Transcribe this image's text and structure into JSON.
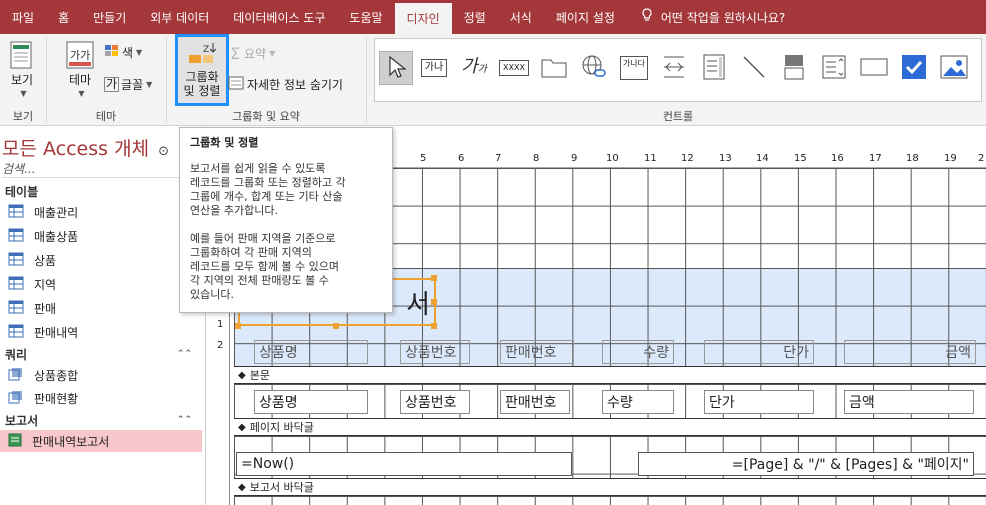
{
  "colors": {
    "accent": "#a4373a",
    "selection": "#1e90ff",
    "nav_selected": "#f7c7cb",
    "section_blue": "#dbe9fb",
    "handle": "#f0a030"
  },
  "tabs": [
    {
      "label": "파일"
    },
    {
      "label": "홈"
    },
    {
      "label": "만들기"
    },
    {
      "label": "외부 데이터"
    },
    {
      "label": "데이터베이스 도구"
    },
    {
      "label": "도움말"
    },
    {
      "label": "디자인",
      "active": true
    },
    {
      "label": "정렬"
    },
    {
      "label": "서식"
    },
    {
      "label": "페이지 설정"
    }
  ],
  "tell_me": "어떤 작업을 원하시나요?",
  "ribbon": {
    "view": {
      "button": "보기",
      "group": "보기"
    },
    "theme": {
      "button": "테마",
      "color": "색",
      "font": "글꼴",
      "group": "테마"
    },
    "grouping": {
      "button_line1": "그룹화",
      "button_line2": "및 정렬",
      "summary": "요약",
      "hide_details": "자세한 정보 숨기기",
      "group": "그룹화 및 요약"
    },
    "controls": {
      "group": "컨트롤",
      "textbox_sample": "가나",
      "label_sample": "가",
      "label_sub": "가",
      "number_sample": "XXXX",
      "image_sample": "가나다"
    }
  },
  "nav": {
    "title": "모든 Access 개체",
    "search_placeholder": "검색...",
    "sections": [
      {
        "label": "테이블",
        "items": [
          "매출관리",
          "매출상품",
          "상품",
          "지역",
          "판매",
          "판매내역"
        ]
      },
      {
        "label": "쿼리",
        "items": [
          "상품종합",
          "판매현황"
        ]
      },
      {
        "label": "보고서",
        "items": [
          "판매내역보고서"
        ]
      }
    ]
  },
  "tooltip": {
    "title": "그룹화 및 정렬",
    "p1": "보고서를 쉽게 읽을 수 있도록\n레코드를 그룹화 또는 정렬하고 각\n그룹에 개수, 합계 또는 기타 산술\n연산을 추가합니다.",
    "p2": "예를 들어 판매 지역을 기준으로\n그룹화하여 각 판매 지역의\n레코드를 모두 함께 볼 수 있으며\n각 지역의 전체 판매량도 볼 수\n있습니다."
  },
  "ruler": {
    "numbers": [
      "5",
      "6",
      "7",
      "8",
      "9",
      "10",
      "11",
      "12",
      "13",
      "14",
      "15",
      "16",
      "17",
      "18",
      "19",
      "2"
    ]
  },
  "vruler": {
    "marks": [
      "1",
      "2"
    ]
  },
  "report": {
    "title_fragment": "서",
    "sections": {
      "detail": "본문",
      "page_footer": "페이지 바닥글",
      "report_footer": "보고서 바닥글"
    },
    "header_labels": [
      "상품명",
      "상품번호",
      "판매번호",
      "수량",
      "단가",
      "금액"
    ],
    "detail_fields": [
      "상품명",
      "상품번호",
      "판매번호",
      "수량",
      "단가",
      "금액"
    ],
    "page_footer_left": "=Now()",
    "page_footer_right": "=[Page] & \"/\" & [Pages] & \"페이지\""
  }
}
